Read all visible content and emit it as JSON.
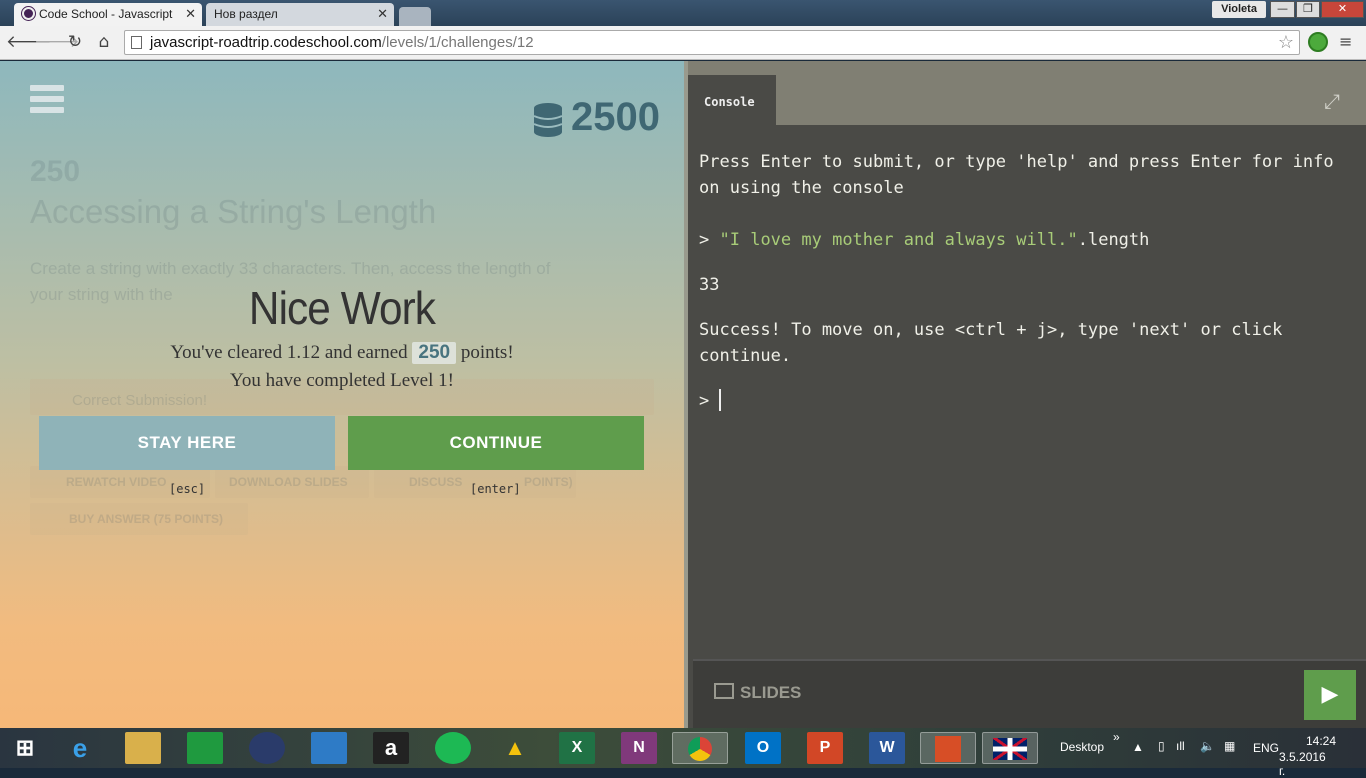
{
  "browser": {
    "tabs": [
      {
        "title": "Code School - Javascript R",
        "close": "✕"
      },
      {
        "title": "Нов раздел",
        "close": "✕"
      }
    ],
    "user": "Violeta",
    "window_buttons": [
      "—",
      "❐",
      "✕"
    ],
    "url_host": "javascript-roadtrip.codeschool.com",
    "url_path": "/levels/1/challenges/12"
  },
  "course": {
    "coins_total": "2500"
  },
  "modal": {
    "title": "Nice Work",
    "line1_prefix": "You've cleared 1.12 and earned",
    "points": "250",
    "line1_suffix": "points!",
    "line2": "You have completed Level 1!",
    "stay_label": "STAY HERE",
    "stay_hint": "[esc]",
    "continue_label": "CONTINUE",
    "continue_hint": "[enter]"
  },
  "background": {
    "points_line": "250",
    "challenge_title": "Accessing a String's Length",
    "task_a": "Create a",
    "task_code1": "string",
    "task_b": "with exactly",
    "task_code2": "33",
    "task_c": "characters. Then, access the length of",
    "task_d": "your",
    "task_code3": "string",
    "task_e": "with the",
    "correct": "Correct Submission!",
    "rewatch": "REWATCH VIDEO",
    "download": "DOWNLOAD SLIDES",
    "discuss": "DISCUSS",
    "points_tag": "POINTS)",
    "buy": "BUY ANSWER (75 POINTS)"
  },
  "console": {
    "tab": "Console",
    "intro": "Press Enter to submit, or type 'help' and press Enter for info on using the console",
    "prompt": ">",
    "input_string": "\"I love my mother and always will.\"",
    "input_suffix": ".length",
    "result": "33",
    "success": "Success! To move on, use <ctrl + j>, type 'next' or click continue.",
    "slides_label": "SLIDES",
    "run_icon": "▶"
  },
  "taskbar": {
    "desktop": "Desktop",
    "lang": "ENG",
    "time": "14:24",
    "date": "3.5.2016 г."
  },
  "colors": {
    "accent_green": "#5f9d4c",
    "stay_button": "#8fb3b8",
    "console_bg": "#4a4a46",
    "string_green": "#a8cc78"
  }
}
